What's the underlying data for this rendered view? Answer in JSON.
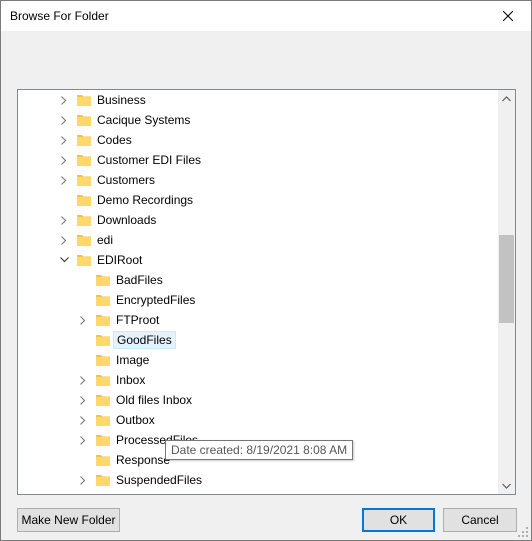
{
  "window": {
    "title": "Browse For Folder"
  },
  "tree": {
    "items": [
      {
        "label": "Business",
        "level": 0,
        "expander": "collapsed"
      },
      {
        "label": "Cacique Systems",
        "level": 0,
        "expander": "collapsed"
      },
      {
        "label": "Codes",
        "level": 0,
        "expander": "collapsed"
      },
      {
        "label": "Customer EDI Files",
        "level": 0,
        "expander": "collapsed"
      },
      {
        "label": "Customers",
        "level": 0,
        "expander": "collapsed"
      },
      {
        "label": "Demo Recordings",
        "level": 0,
        "expander": "none"
      },
      {
        "label": "Downloads",
        "level": 0,
        "expander": "collapsed"
      },
      {
        "label": "edi",
        "level": 0,
        "expander": "collapsed"
      },
      {
        "label": "EDIRoot",
        "level": 0,
        "expander": "expanded"
      },
      {
        "label": "BadFiles",
        "level": 1,
        "expander": "none"
      },
      {
        "label": "EncryptedFiles",
        "level": 1,
        "expander": "none"
      },
      {
        "label": "FTProot",
        "level": 1,
        "expander": "collapsed"
      },
      {
        "label": "GoodFiles",
        "level": 1,
        "expander": "none",
        "hover": true
      },
      {
        "label": "Image",
        "level": 1,
        "expander": "none"
      },
      {
        "label": "Inbox",
        "level": 1,
        "expander": "collapsed"
      },
      {
        "label": "Old files Inbox",
        "level": 1,
        "expander": "collapsed"
      },
      {
        "label": "Outbox",
        "level": 1,
        "expander": "collapsed"
      },
      {
        "label": "ProcessedFiles",
        "level": 1,
        "expander": "collapsed"
      },
      {
        "label": "Response",
        "level": 1,
        "expander": "none"
      },
      {
        "label": "SuspendedFiles",
        "level": 1,
        "expander": "collapsed"
      }
    ]
  },
  "tooltip": {
    "text": "Date created: 8/19/2021 8:08 AM"
  },
  "buttons": {
    "make_new_folder": "Make New Folder",
    "ok": "OK",
    "cancel": "Cancel"
  },
  "colors": {
    "folder": "#ffd86b",
    "folder_tab": "#f5c343",
    "accent": "#0078d7"
  }
}
